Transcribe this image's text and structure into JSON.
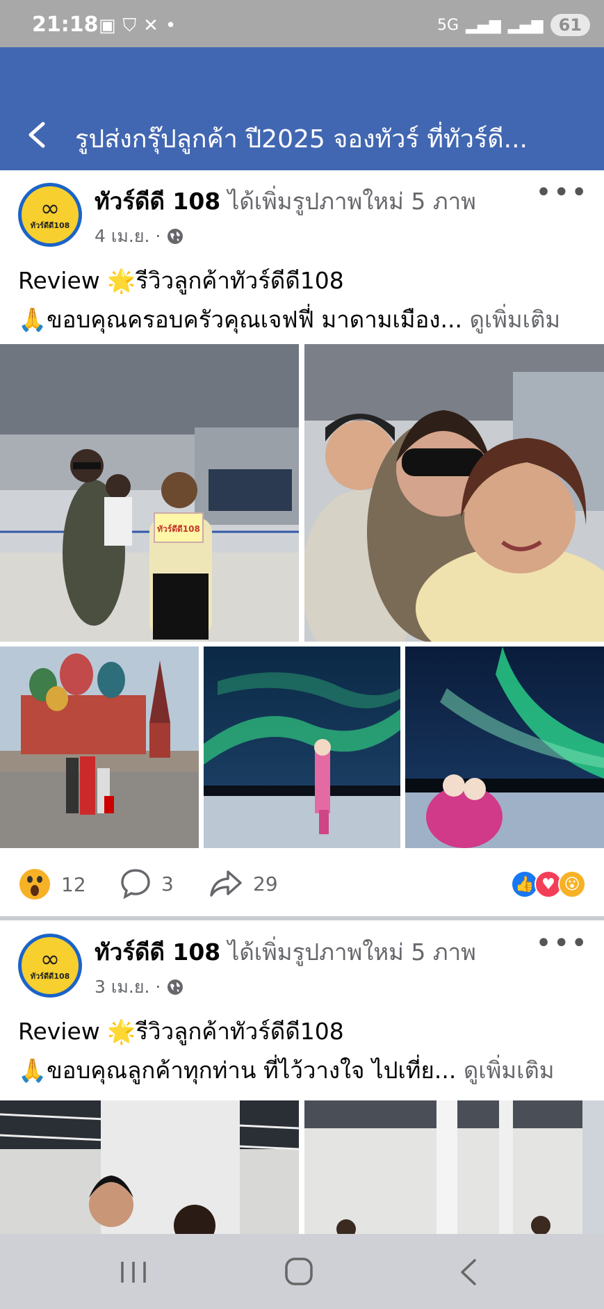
{
  "status_bar": {
    "time": "21:18",
    "signal": "5G",
    "battery": "61"
  },
  "header": {
    "title": "รูปส่งกรุ๊ปลูกค้า ปี2025 จองทัวร์ ที่ทัวร์ดี..."
  },
  "posts": [
    {
      "author": "ทัวร์ดีดี 108",
      "action": "ได้เพิ่มรูปภาพใหม่ 5 ภาพ",
      "date": "4 เม.ย. ·",
      "line1": "Review 🌟รีวิวลูกค้าทัวร์ดีดี108",
      "line2": "🙏ขอบคุณครอบครัวคุณเจฟฟี่ มาดามเมือง...",
      "see_more": "ดูเพิ่มเติม",
      "reaction_count": "12",
      "comment_count": "3",
      "share_count": "29",
      "avatar_text": "ทัวร์ดีดี108"
    },
    {
      "author": "ทัวร์ดีดี 108",
      "action": "ได้เพิ่มรูปภาพใหม่ 5 ภาพ",
      "date": "3 เม.ย. ·",
      "line1": "Review 🌟รีวิวลูกค้าทัวร์ดีดี108",
      "line2": "🙏ขอบคุณลูกค้าทุกท่าน ที่ไว้วางใจ ไปเที่ย...",
      "see_more": "ดูเพิ่มเติม",
      "avatar_text": "ทัวร์ดีดี108"
    }
  ],
  "photo_sign_text": "ทัวร์ดีดี108",
  "colors": {
    "header_bg": "#4267b2",
    "status_bg": "#a8a8a8",
    "like_blue": "#1877f2",
    "love_red": "#f33e58"
  },
  "icons": [
    "back-arrow-icon",
    "globe-icon",
    "more-icon",
    "wow-emoji-icon",
    "comment-icon",
    "share-icon",
    "like-reaction-icon",
    "love-reaction-icon",
    "recents-icon",
    "home-icon",
    "nav-back-icon"
  ]
}
